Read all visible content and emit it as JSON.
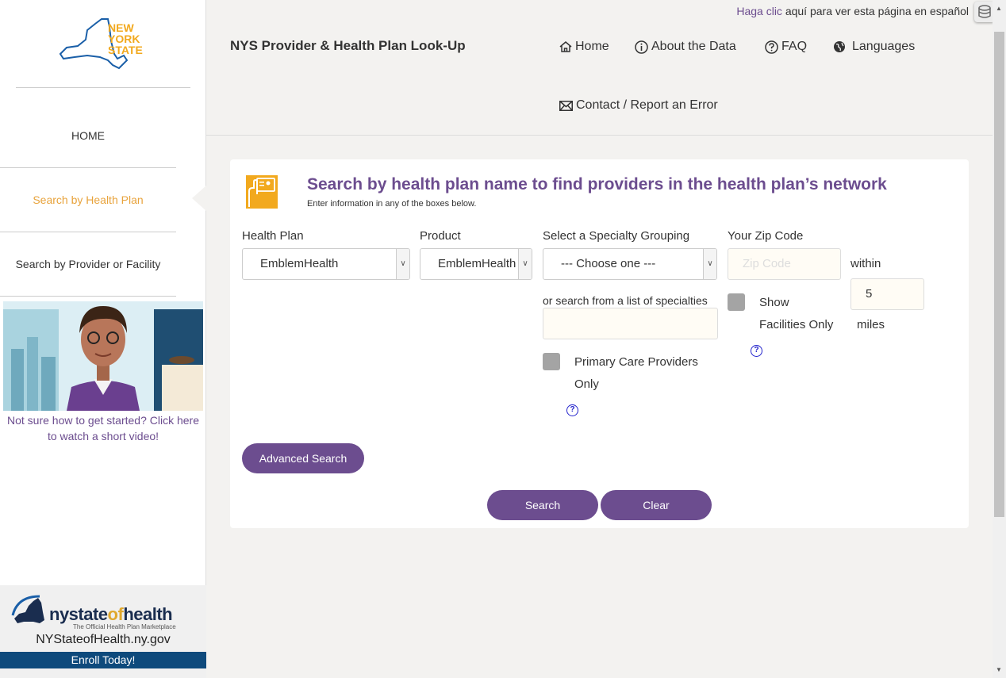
{
  "header": {
    "spanish_link_text": "Haga clic",
    "spanish_rest": " aquí para ver esta página en español",
    "app_title": "NYS Provider & Health Plan Look-Up",
    "nav": {
      "home": "Home",
      "about": "About the Data",
      "faq": "FAQ",
      "languages": "Languages",
      "contact": "Contact / Report an Error"
    }
  },
  "sidebar": {
    "logo_lines": [
      "NEW",
      "YORK",
      "STATE"
    ],
    "items": [
      {
        "label": "HOME"
      },
      {
        "label": "Search by Health Plan"
      },
      {
        "label": "Search by Provider or Facility"
      }
    ],
    "video_caption": "Not sure how to get started? Click here to watch a short video!",
    "nysoh": {
      "brand_part1": "nystate",
      "brand_part2": "of",
      "brand_part3": "health",
      "tagline": "The Official Health Plan Marketplace",
      "url": "NYStateofHealth.ny.gov",
      "enroll": "Enroll Today!"
    }
  },
  "card": {
    "title": "Search by health plan name to find providers in the health plan’s network",
    "subtitle": "Enter information in any of the boxes below.",
    "health_plan": {
      "label": "Health Plan",
      "value": "EmblemHealth"
    },
    "product": {
      "label": "Product",
      "value": "EmblemHealth"
    },
    "specialty": {
      "label": "Select a Specialty Grouping",
      "value": "--- Choose one ---"
    },
    "specialty_list_label": "or search from a list of specialties",
    "specialty_list_value": "",
    "zip": {
      "label": "Your Zip Code",
      "placeholder": "Zip Code",
      "value": ""
    },
    "within_label": "within",
    "miles_value": "5",
    "miles_label": "miles",
    "pcp_line1": "Primary Care Providers",
    "pcp_line2": "Only",
    "facilities_line1": "Show",
    "facilities_line2": "Facilities Only",
    "help_glyph": "?",
    "advanced_search": "Advanced Search",
    "search": "Search",
    "clear": "Clear"
  },
  "colors": {
    "accent_purple": "#6c4d8f",
    "accent_orange": "#e8a33c",
    "nysoh_blue": "#0e4a7c"
  },
  "icons": [
    "home-icon",
    "info-icon",
    "question-icon",
    "globe-icon",
    "envelope-icon",
    "id-card-icon",
    "chevron-down-icon",
    "help-icon",
    "tool-icon"
  ]
}
